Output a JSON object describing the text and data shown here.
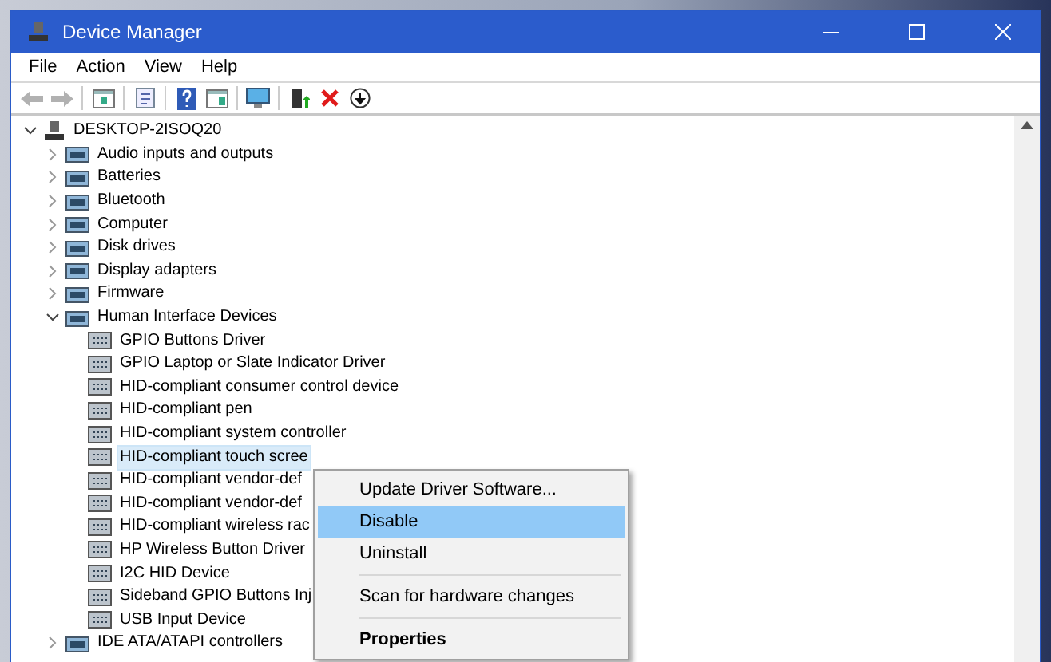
{
  "window": {
    "title": "Device Manager"
  },
  "menu": [
    "File",
    "Action",
    "View",
    "Help"
  ],
  "toolbar": [
    {
      "kind": "back",
      "disabled": true
    },
    {
      "kind": "forward",
      "disabled": true
    },
    {
      "kind": "sep"
    },
    {
      "kind": "panel",
      "disabled": false
    },
    {
      "kind": "sep"
    },
    {
      "kind": "properties",
      "disabled": false
    },
    {
      "kind": "sep"
    },
    {
      "kind": "help",
      "disabled": false
    },
    {
      "kind": "panel2",
      "disabled": false
    },
    {
      "kind": "sep"
    },
    {
      "kind": "monitor",
      "disabled": false
    },
    {
      "kind": "sep"
    },
    {
      "kind": "update",
      "disabled": false
    },
    {
      "kind": "remove",
      "disabled": false
    },
    {
      "kind": "download",
      "disabled": false
    }
  ],
  "tree": [
    {
      "label": "DESKTOP-2ISOQ20",
      "expanded": true,
      "selected": false,
      "children": [
        {
          "label": "Audio inputs and outputs",
          "expanded": false,
          "selected": false
        },
        {
          "label": "Batteries",
          "expanded": false,
          "selected": false
        },
        {
          "label": "Bluetooth",
          "expanded": false,
          "selected": false
        },
        {
          "label": "Computer",
          "expanded": false,
          "selected": false
        },
        {
          "label": "Disk drives",
          "expanded": false,
          "selected": false
        },
        {
          "label": "Display adapters",
          "expanded": false,
          "selected": false
        },
        {
          "label": "Firmware",
          "expanded": false,
          "selected": false
        },
        {
          "label": "Human Interface Devices",
          "expanded": true,
          "selected": false,
          "children": [
            {
              "label": "GPIO Buttons Driver",
              "selected": false
            },
            {
              "label": "GPIO Laptop or Slate Indicator Driver",
              "selected": false
            },
            {
              "label": "HID-compliant consumer control device",
              "selected": false
            },
            {
              "label": "HID-compliant pen",
              "selected": false
            },
            {
              "label": "HID-compliant system controller",
              "selected": false
            },
            {
              "label": "HID-compliant touch scree",
              "selected": true
            },
            {
              "label": "HID-compliant vendor-def",
              "selected": false
            },
            {
              "label": "HID-compliant vendor-def",
              "selected": false
            },
            {
              "label": "HID-compliant wireless rac",
              "selected": false
            },
            {
              "label": "HP Wireless Button Driver",
              "selected": false
            },
            {
              "label": "I2C HID Device",
              "selected": false
            },
            {
              "label": "Sideband GPIO Buttons Inj",
              "selected": false
            },
            {
              "label": "USB Input Device",
              "selected": false
            }
          ]
        },
        {
          "label": "IDE ATA/ATAPI controllers",
          "expanded": false,
          "selected": false
        }
      ]
    }
  ],
  "context_menu": {
    "groups": [
      [
        {
          "label": "Update Driver Software...",
          "selected": false,
          "kind": "normal"
        },
        {
          "label": "Disable",
          "selected": true,
          "kind": "normal"
        },
        {
          "label": "Uninstall",
          "selected": false,
          "kind": "normal"
        }
      ],
      [
        {
          "label": "Scan for hardware changes",
          "selected": false,
          "kind": "normal"
        }
      ],
      [
        {
          "label": "Properties",
          "selected": false,
          "kind": "default"
        }
      ]
    ]
  }
}
